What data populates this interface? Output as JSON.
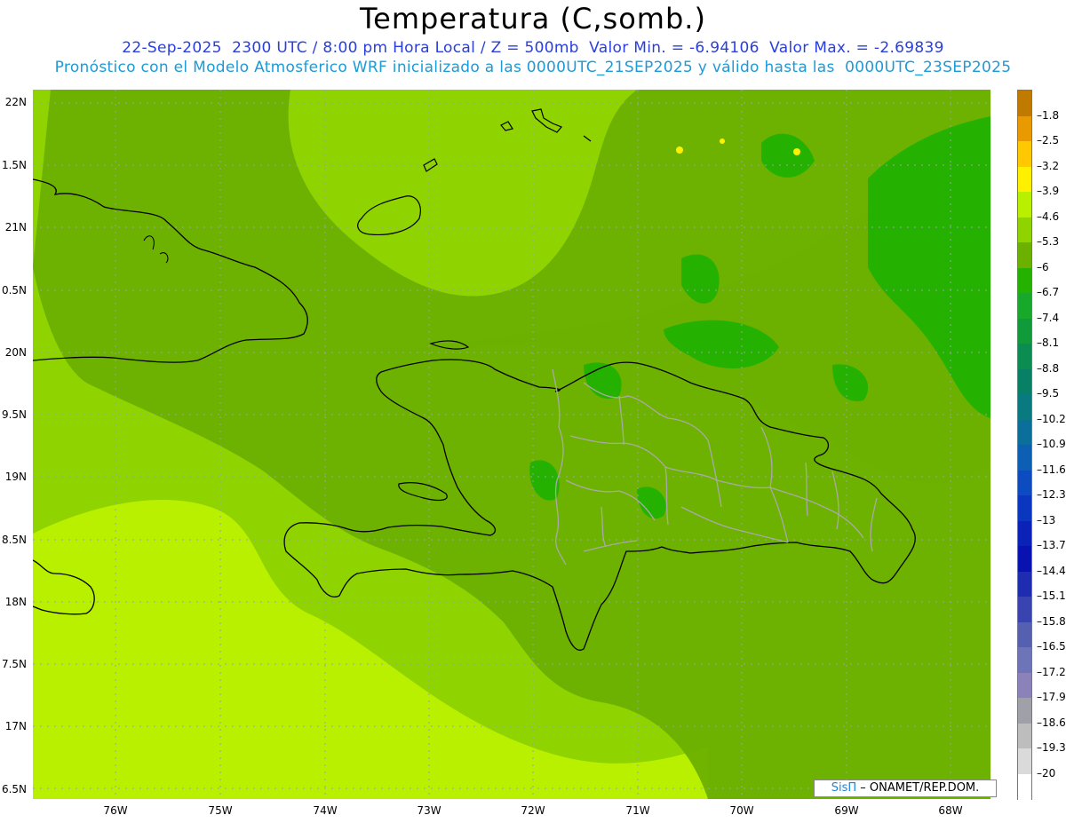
{
  "header": {
    "title": "Temperatura (C,somb.)",
    "line1": "22-Sep-2025  2300 UTC / 8:00 pm Hora Local / Z = 500mb  Valor Min. = -6.94106  Valor Max. = -2.69839",
    "line2": "Pronóstico con el Modelo Atmosferico WRF inicializado a las 0000UTC_21SEP2025 y válido hasta las  0000UTC_23SEP2025"
  },
  "axes": {
    "lat_labels": [
      "22N",
      "1.5N",
      "21N",
      "0.5N",
      "20N",
      "9.5N",
      "19N",
      "8.5N",
      "18N",
      "7.5N",
      "17N",
      "6.5N"
    ],
    "lon_labels": [
      "76W",
      "75W",
      "74W",
      "73W",
      "72W",
      "71W",
      "70W",
      "69W",
      "68W"
    ]
  },
  "legend": {
    "labels": [
      "-1.8",
      "-2.5",
      "-3.2",
      "-3.9",
      "-4.6",
      "-5.3",
      "-6",
      "-6.7",
      "-7.4",
      "-8.1",
      "-8.8",
      "-9.5",
      "-10.2",
      "-10.9",
      "-11.6",
      "-12.3",
      "-13",
      "-13.7",
      "-14.4",
      "-15.1",
      "-15.8",
      "-16.5",
      "-17.2",
      "-17.9",
      "-18.6",
      "-19.3",
      "-20"
    ],
    "colors": [
      "#c07a00",
      "#e89a00",
      "#ffc800",
      "#fff000",
      "#b8f000",
      "#8fd400",
      "#6cb000",
      "#25b100",
      "#18a82a",
      "#109a3a",
      "#0b8c50",
      "#088065",
      "#087a80",
      "#0a6f9a",
      "#0c5fb2",
      "#0c4cc0",
      "#0a36c0",
      "#0a22b8",
      "#0812b0",
      "#1d2cb0",
      "#3a44b0",
      "#5560b0",
      "#6e74b8",
      "#8a82b8",
      "#a0a0a8",
      "#bdbdbd",
      "#dadada",
      "#ffffff"
    ]
  },
  "colors": {
    "base_field": "#8fd400",
    "lighter_field": "#b8f000",
    "darker_field": "#6cb000",
    "dark_patches": "#25b100",
    "coast": "#000000",
    "provinces": "#aaaaaa"
  },
  "credit": {
    "brand": "SisΠ",
    "org": " – ONAMET/REP.DOM."
  }
}
